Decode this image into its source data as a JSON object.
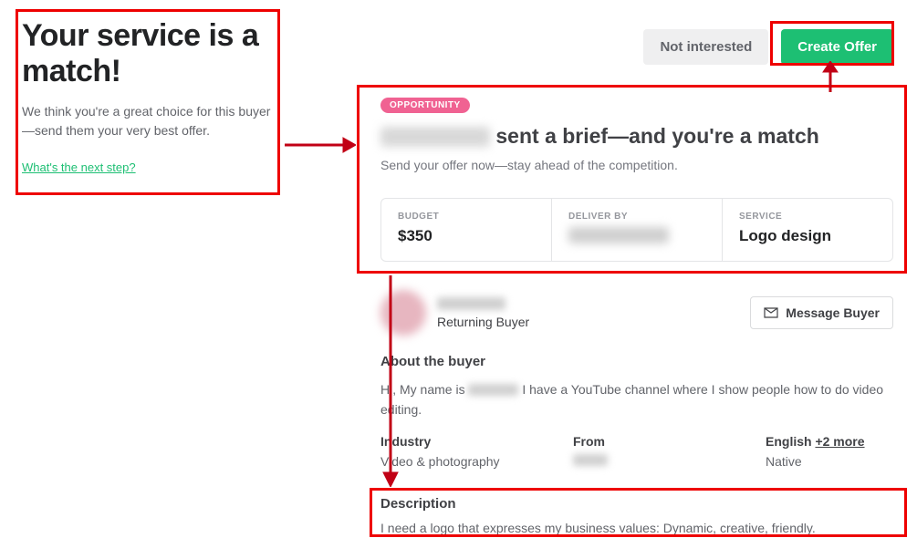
{
  "left": {
    "title": "Your service is a match!",
    "subtitle": "We think you're a great choice for this buyer—send them your very best offer.",
    "next_step": "What's the next step?"
  },
  "actions": {
    "not_interested": "Not interested",
    "create_offer": "Create  Offer"
  },
  "opportunity": {
    "pill": "OPPORTUNITY",
    "headline_suffix": " sent a brief—and you're a match",
    "subline": "Send your offer now—stay ahead of the competition.",
    "budget_label": "BUDGET",
    "budget_value": "$350",
    "deliver_label": "DELIVER BY",
    "service_label": "SERVICE",
    "service_value": "Logo design"
  },
  "buyer": {
    "returning": "Returning Buyer",
    "message_btn": "Message Buyer",
    "about_heading": "About the buyer",
    "about_prefix": "Hi, My name is ",
    "about_suffix": " I have a YouTube channel where I show people how to do video editing.",
    "industry_label": "Industry",
    "industry_value": "Video & photography",
    "from_label": "From",
    "lang_label": "English",
    "lang_more": "+2 more",
    "lang_value": "Native"
  },
  "description": {
    "heading": "Description",
    "text": "I need a logo that expresses my business values: Dynamic, creative, friendly."
  }
}
